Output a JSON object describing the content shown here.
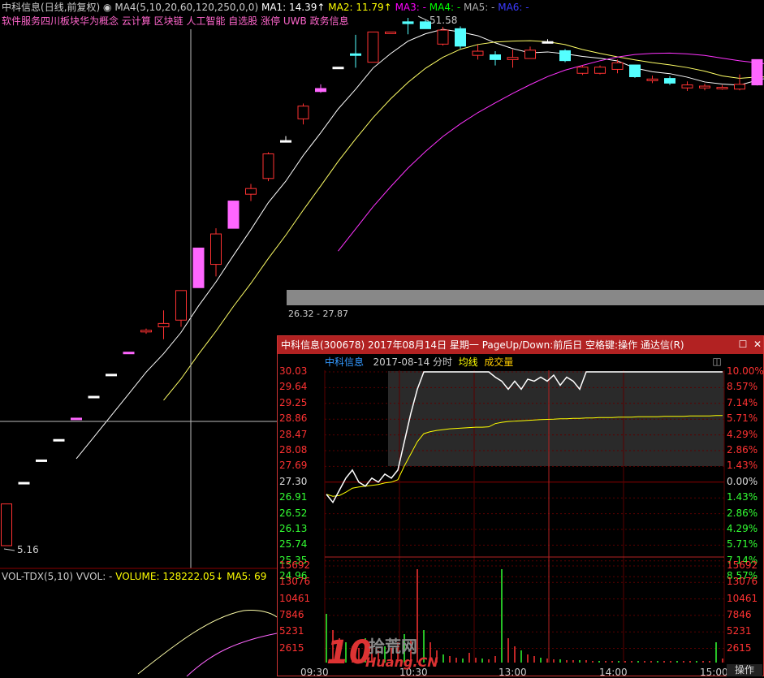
{
  "header": {
    "stock_name": "中科信息",
    "period": "(日线,前复权)",
    "ma_label": "MA4(5,10,20,60,120,250,0,0)",
    "ma1": "MA1: 14.39↑",
    "ma2": "MA2: 11.79↑",
    "ma3": "MA3: -",
    "ma4": "MA4: -",
    "ma5": "MA5: -",
    "ma6": "MA6: -",
    "colors": {
      "ma1": "#ffffff",
      "ma2": "#ffff00",
      "ma3": "#ff00ff",
      "ma4": "#00ff00",
      "ma5": "#aaaaaa",
      "ma6": "#3333ff"
    }
  },
  "concepts": "软件服务四川板块华为概念 云计算 区块链 人工智能 自选股 涨停 UWB 政务信息",
  "annotations": {
    "high_price": "51.58",
    "low_price": "5.16",
    "range_label": "26.32 - 27.87"
  },
  "volume_header": {
    "name": "VOL-TDX(5,10)",
    "vvol": "VVOL: -",
    "volume": "VOLUME: 128222.05↓",
    "ma5": "MA5: 69"
  },
  "popup": {
    "title": "中科信息(300678) 2017年08月14日 星期一 PageUp/Down:前后日 空格键:操作 通达信(R)",
    "close_icon": "close-icon",
    "sub_stock": "中科信息",
    "sub_date": "2017-08-14 分时",
    "sub_avg": "均线",
    "sub_vol": "成交量",
    "price_labels": [
      "30.03",
      "29.64",
      "29.25",
      "28.86",
      "28.47",
      "28.08",
      "27.69",
      "27.30",
      "26.91",
      "26.52",
      "26.13",
      "25.74",
      "25.35",
      "24.96"
    ],
    "pct_labels": [
      "10.00%",
      "8.57%",
      "7.14%",
      "5.71%",
      "4.29%",
      "2.86%",
      "1.43%",
      "0.00%",
      "1.43%",
      "2.86%",
      "4.29%",
      "5.71%",
      "7.14%",
      "8.57%"
    ],
    "vol_labels": [
      "15692",
      "13076",
      "10461",
      "7846",
      "5231",
      "2615"
    ],
    "time_labels": [
      "09:30",
      "10:30",
      "13:00",
      "14:00",
      "15:00"
    ],
    "op_button": "操作"
  },
  "watermark": {
    "logo": "10",
    "chinese": "拾荒网",
    "english": "Huang.CN"
  },
  "chart_data": {
    "type": "candlestick",
    "daily_candles": [
      {
        "o": 5.16,
        "c": 6.19,
        "h": 6.19,
        "l": 5.16,
        "color": "red"
      },
      {
        "o": 6.8,
        "c": 6.8,
        "h": 6.8,
        "l": 6.8,
        "color": "white"
      },
      {
        "o": 7.5,
        "c": 7.5,
        "h": 7.5,
        "l": 7.5,
        "color": "white"
      },
      {
        "o": 8.2,
        "c": 8.2,
        "h": 8.2,
        "l": 8.2,
        "color": "white"
      },
      {
        "o": 9.0,
        "c": 9.0,
        "h": 9.0,
        "l": 9.0,
        "color": "magenta"
      },
      {
        "o": 9.9,
        "c": 9.9,
        "h": 9.9,
        "l": 9.9,
        "color": "white"
      },
      {
        "o": 10.9,
        "c": 10.9,
        "h": 10.9,
        "l": 10.9,
        "color": "white"
      },
      {
        "o": 12.0,
        "c": 12.0,
        "h": 12.0,
        "l": 12.0,
        "color": "magenta"
      },
      {
        "o": 13.2,
        "c": 13.2,
        "h": 13.3,
        "l": 13.0,
        "color": "red"
      },
      {
        "o": 13.4,
        "c": 13.6,
        "h": 14.4,
        "l": 12.7,
        "color": "red"
      },
      {
        "o": 13.8,
        "c": 15.7,
        "h": 15.7,
        "l": 13.4,
        "color": "red"
      },
      {
        "o": 15.9,
        "c": 18.9,
        "h": 18.9,
        "l": 15.9,
        "color": "magenta"
      },
      {
        "o": 17.6,
        "c": 20.1,
        "h": 20.6,
        "l": 16.7,
        "color": "red"
      },
      {
        "o": 20.6,
        "c": 23.2,
        "h": 23.2,
        "l": 20.6,
        "color": "magenta"
      },
      {
        "o": 23.9,
        "c": 24.5,
        "h": 25.0,
        "l": 23.2,
        "color": "red"
      },
      {
        "o": 25.6,
        "c": 28.5,
        "h": 28.7,
        "l": 25.3,
        "color": "red"
      },
      {
        "o": 30.2,
        "c": 30.2,
        "h": 30.8,
        "l": 30.2,
        "color": "white"
      },
      {
        "o": 33.2,
        "c": 35.1,
        "h": 35.5,
        "l": 32.4,
        "color": "red"
      },
      {
        "o": 37.4,
        "c": 37.9,
        "h": 38.6,
        "l": 37.2,
        "color": "magenta"
      },
      {
        "o": 41.6,
        "c": 41.6,
        "h": 41.6,
        "l": 41.6,
        "color": "white"
      },
      {
        "o": 44.1,
        "c": 44.1,
        "h": 47.9,
        "l": 41.5,
        "color": "cyan"
      },
      {
        "o": 42.5,
        "c": 48.5,
        "h": 48.5,
        "l": 42.5,
        "color": "red"
      },
      {
        "o": 48.5,
        "c": 48.5,
        "h": 48.5,
        "l": 48.5,
        "color": "red"
      },
      {
        "o": 50.7,
        "c": 50.3,
        "h": 51.58,
        "l": 48.0,
        "color": "cyan"
      },
      {
        "o": 50.7,
        "c": 49.2,
        "h": 51.1,
        "l": 49.2,
        "color": "cyan"
      },
      {
        "o": 46.0,
        "c": 48.9,
        "h": 49.6,
        "l": 45.7,
        "color": "red"
      },
      {
        "o": 49.2,
        "c": 45.6,
        "h": 49.7,
        "l": 45.1,
        "color": "cyan"
      },
      {
        "o": 43.8,
        "c": 44.6,
        "h": 45.9,
        "l": 43.0,
        "color": "red"
      },
      {
        "o": 43.9,
        "c": 43.0,
        "h": 44.6,
        "l": 41.9,
        "color": "cyan"
      },
      {
        "o": 43.0,
        "c": 43.4,
        "h": 44.9,
        "l": 41.5,
        "color": "red"
      },
      {
        "o": 43.2,
        "c": 44.8,
        "h": 45.5,
        "l": 43.2,
        "color": "red"
      },
      {
        "o": 46.5,
        "c": 46.5,
        "h": 47.0,
        "l": 46.5,
        "color": "white"
      },
      {
        "o": 44.7,
        "c": 42.8,
        "h": 45.0,
        "l": 42.5,
        "color": "cyan"
      },
      {
        "o": 41.6,
        "c": 40.5,
        "h": 41.9,
        "l": 40.2,
        "color": "red"
      },
      {
        "o": 40.5,
        "c": 41.6,
        "h": 41.9,
        "l": 40.3,
        "color": "red"
      },
      {
        "o": 41.2,
        "c": 42.4,
        "h": 43.0,
        "l": 40.5,
        "color": "red"
      },
      {
        "o": 42.0,
        "c": 39.9,
        "h": 42.0,
        "l": 39.7,
        "color": "cyan"
      },
      {
        "o": 39.5,
        "c": 39.5,
        "h": 40.1,
        "l": 38.8,
        "color": "red"
      },
      {
        "o": 39.6,
        "c": 38.8,
        "h": 40.0,
        "l": 38.5,
        "color": "cyan"
      },
      {
        "o": 38.0,
        "c": 38.5,
        "h": 39.1,
        "l": 37.5,
        "color": "red"
      },
      {
        "o": 38.0,
        "c": 38.3,
        "h": 38.7,
        "l": 37.6,
        "color": "red"
      },
      {
        "o": 38.1,
        "c": 38.1,
        "h": 38.5,
        "l": 37.7,
        "color": "red"
      },
      {
        "o": 37.8,
        "c": 38.6,
        "h": 40.3,
        "l": 37.6,
        "color": "red"
      },
      {
        "o": 38.5,
        "c": 43.0,
        "h": 43.0,
        "l": 38.4,
        "color": "magenta"
      },
      {
        "o": 43.0,
        "c": 41.6,
        "h": 43.6,
        "l": 39.3,
        "color": "cyan"
      }
    ],
    "intraday": {
      "prev_close": 27.3,
      "ylim": [
        24.96,
        30.03
      ],
      "price": [
        27.0,
        26.8,
        27.1,
        27.4,
        27.6,
        27.3,
        27.2,
        27.4,
        27.3,
        27.5,
        27.4,
        27.6,
        28.3,
        29.0,
        29.6,
        30.03,
        30.03,
        30.03,
        30.03,
        30.03,
        30.03,
        30.03,
        30.03,
        30.03,
        30.03,
        30.03,
        29.9,
        29.8,
        29.6,
        29.8,
        29.6,
        29.85,
        29.8,
        29.9,
        29.8,
        29.95,
        29.7,
        29.9,
        29.8,
        29.6,
        30.03,
        30.03,
        30.03,
        30.03,
        30.03,
        30.03,
        30.03,
        30.03,
        30.03,
        30.03,
        30.03,
        30.03,
        30.03,
        30.03,
        30.03,
        30.03,
        30.03,
        30.03,
        30.03,
        30.03,
        30.03,
        30.03
      ],
      "avg": [
        27.0,
        26.95,
        26.97,
        27.05,
        27.15,
        27.18,
        27.2,
        27.22,
        27.24,
        27.28,
        27.3,
        27.36,
        27.7,
        28.0,
        28.3,
        28.5,
        28.55,
        28.58,
        28.6,
        28.62,
        28.63,
        28.64,
        28.65,
        28.66,
        28.66,
        28.67,
        28.75,
        28.78,
        28.8,
        28.81,
        28.82,
        28.83,
        28.84,
        28.85,
        28.855,
        28.86,
        28.87,
        28.87,
        28.88,
        28.88,
        28.89,
        28.89,
        28.9,
        28.9,
        28.9,
        28.91,
        28.91,
        28.91,
        28.92,
        28.92,
        28.92,
        28.92,
        28.93,
        28.93,
        28.93,
        28.93,
        28.94,
        28.94,
        28.94,
        28.94,
        28.95,
        28.95
      ]
    }
  }
}
